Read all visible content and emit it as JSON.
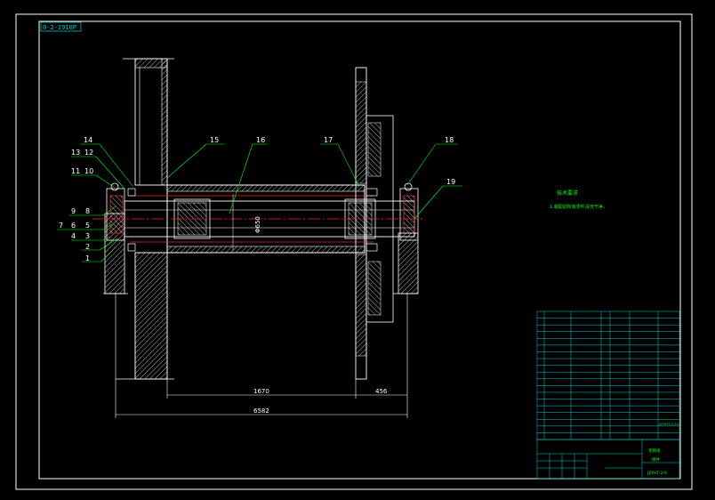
{
  "title_tag": "0-2-1910P",
  "callouts": {
    "c1": "1",
    "c2": "2",
    "c3": "3",
    "c4": "4",
    "c5": "5",
    "c6": "6",
    "c7": "7",
    "c8": "8",
    "c9": "9",
    "c10": "10",
    "c11": "11",
    "c12": "12",
    "c13": "13",
    "c14": "14",
    "c15": "15",
    "c16": "16",
    "c17": "17",
    "c18": "18",
    "c19": "19"
  },
  "dimensions": {
    "d1670": "1670",
    "d456": "456",
    "d6582": "6582",
    "d650": "Φ650"
  },
  "notes": {
    "heading": "技术要求",
    "line1": "1.装配前所有零件清洗干净。"
  },
  "title_block": {
    "name": "卷筒组",
    "material": "组件",
    "drawing_no": "JZYHT-2-0",
    "bom_code": "JZYHTT-2-10"
  },
  "colors": {
    "outline": "#ffffff",
    "part": "#ffffff",
    "centerline": "#ff2020",
    "callout": "#00ff00",
    "table": "#00d0d0",
    "hatch": "#ffffff"
  }
}
